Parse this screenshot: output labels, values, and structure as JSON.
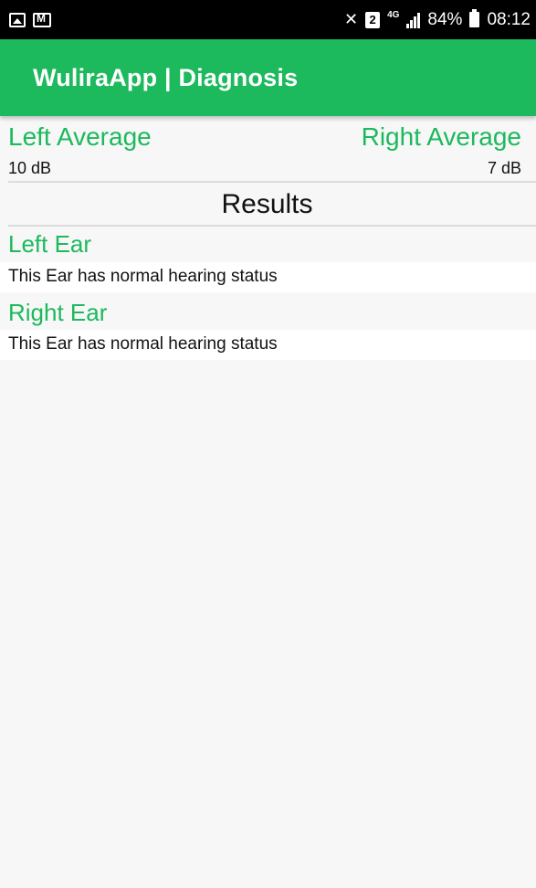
{
  "status_bar": {
    "icons_left": [
      "picture-icon",
      "mail-icon"
    ],
    "sim": "2",
    "network": "4G",
    "battery": "84%",
    "time": "08:12"
  },
  "app_bar": {
    "title": "WuliraApp | Diagnosis"
  },
  "averages": {
    "left": {
      "label": "Left Average",
      "value": "10 dB"
    },
    "right": {
      "label": "Right Average",
      "value": "7 dB"
    }
  },
  "results": {
    "title": "Results",
    "ears": [
      {
        "title": "Left Ear",
        "status": "This Ear has normal hearing status"
      },
      {
        "title": "Right Ear",
        "status": "This Ear has normal hearing status"
      }
    ]
  },
  "colors": {
    "accent": "#1cb95d",
    "background": "#f7f7f7",
    "status_bar": "#000000"
  }
}
